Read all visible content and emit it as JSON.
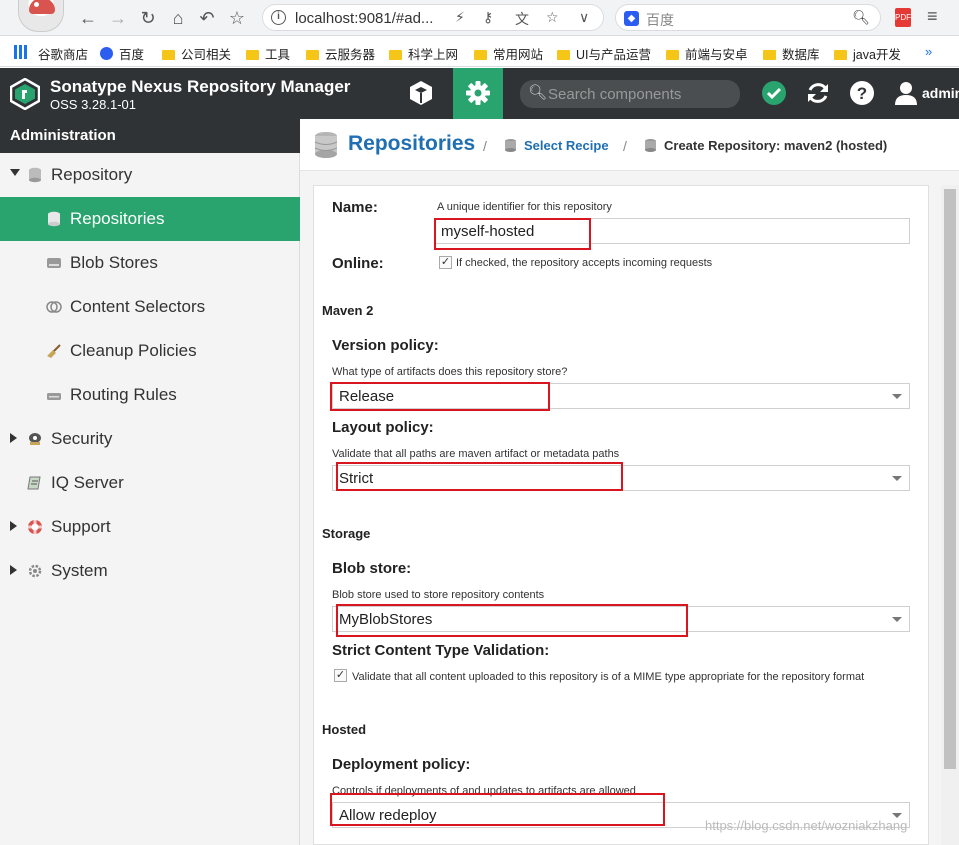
{
  "browser": {
    "url": "localhost:9081/#ad...",
    "search_engine": "百度",
    "bookmarks": [
      "谷歌商店",
      "百度",
      "公司相关",
      "工具",
      "云服务器",
      "科学上网",
      "常用网站",
      "UI与产品运营",
      "前端与安卓",
      "数据库",
      "java开发"
    ],
    "more": "»"
  },
  "header": {
    "title": "Sonatype Nexus Repository Manager",
    "version": "OSS 3.28.1-01",
    "search_placeholder": "Search components",
    "user": "admin",
    "accent": "#29a46f"
  },
  "sidebar": {
    "title": "Administration",
    "items": [
      {
        "label": "Repository",
        "icon": "database-icon",
        "expanded": true
      },
      {
        "label": "Repositories",
        "icon": "database-icon",
        "active": true
      },
      {
        "label": "Blob Stores",
        "icon": "hard-drive-icon"
      },
      {
        "label": "Content Selectors",
        "icon": "content-selector-icon"
      },
      {
        "label": "Cleanup Policies",
        "icon": "broom-icon"
      },
      {
        "label": "Routing Rules",
        "icon": "router-icon"
      },
      {
        "label": "Security",
        "icon": "security-icon"
      },
      {
        "label": "IQ Server",
        "icon": "iq-server-icon"
      },
      {
        "label": "Support",
        "icon": "support-icon"
      },
      {
        "label": "System",
        "icon": "system-gear-icon"
      }
    ]
  },
  "breadcrumb": {
    "title": "Repositories",
    "sep": "/",
    "recipe": "Select Recipe",
    "create": "Create Repository: maven2 (hosted)"
  },
  "form": {
    "name_label": "Name:",
    "name_help": "A unique identifier for this repository",
    "name_value": "myself-hosted",
    "online_label": "Online:",
    "online_help": "If checked, the repository accepts incoming requests",
    "online_checked": true,
    "maven_section": "Maven 2",
    "version_label": "Version policy:",
    "version_help": "What type of artifacts does this repository store?",
    "version_value": "Release",
    "layout_label": "Layout policy:",
    "layout_help": "Validate that all paths are maven artifact or metadata paths",
    "layout_value": "Strict",
    "storage_section": "Storage",
    "blob_label": "Blob store:",
    "blob_help": "Blob store used to store repository contents",
    "blob_value": "MyBlobStores",
    "strict_label": "Strict Content Type Validation:",
    "strict_help": "Validate that all content uploaded to this repository is of a MIME type appropriate for the repository format",
    "strict_checked": true,
    "hosted_section": "Hosted",
    "deploy_label": "Deployment policy:",
    "deploy_help": "Controls if deployments of and updates to artifacts are allowed",
    "deploy_value": "Allow redeploy"
  },
  "watermark": "https://blog.csdn.net/wozniakzhang",
  "highlight_color": "#d9161f"
}
